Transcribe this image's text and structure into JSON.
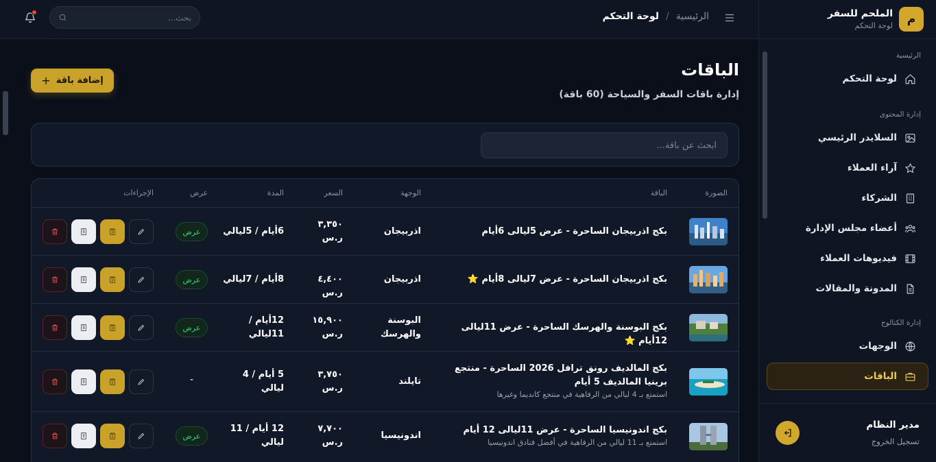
{
  "sidebar": {
    "brand_initial": "م",
    "brand_name": "الملحم للسفر",
    "brand_sub": "لوحة التحكم",
    "sections": [
      {
        "title": "الرئيسية"
      },
      {
        "title": "إدارة المحتوى"
      },
      {
        "title": "إدارة الكتالوج"
      }
    ],
    "items": [
      {
        "label": "لوحة التحكم",
        "icon": "home-icon"
      },
      {
        "label": "السلايدر الرئيسي",
        "icon": "image-icon"
      },
      {
        "label": "آراء العملاء",
        "icon": "star-icon"
      },
      {
        "label": "الشركاء",
        "icon": "building-icon"
      },
      {
        "label": "أعضاء مجلس الإدارة",
        "icon": "users-icon"
      },
      {
        "label": "فيديوهات العملاء",
        "icon": "film-icon"
      },
      {
        "label": "المدونة والمقالات",
        "icon": "document-icon"
      },
      {
        "label": "الوجهات",
        "icon": "globe-icon"
      },
      {
        "label": "الباقات",
        "icon": "briefcase-icon",
        "active": true
      }
    ],
    "user_name": "مدير النظام",
    "logout_label": "تسجيل الخروج"
  },
  "topbar": {
    "breadcrumb_home": "الرئيسية",
    "breadcrumb_sep": "/",
    "breadcrumb_current": "لوحة التحكم",
    "search_placeholder": "بحث..."
  },
  "page": {
    "title": "الباقات",
    "subtitle": "إدارة باقات السفر والسياحة (60 باقة)",
    "add_button": "إضافة باقة",
    "filter_placeholder": "ابحث عن باقة..."
  },
  "table": {
    "headers": {
      "image": "الصورة",
      "package": "الباقة",
      "destination": "الوجهة",
      "price": "السعر",
      "duration": "المدة",
      "display": "عرض",
      "actions": "الإجراءات"
    },
    "rows": [
      {
        "title": "بكج اذربيجان الساحرة - عرض 5ليالى 6أيام",
        "desc": "",
        "destination": "اذربيجان",
        "price": "٣,٣٥٠ ر.س",
        "duration": "6أيام / 5ليالي",
        "status": "عرض",
        "thumb": "city"
      },
      {
        "title": "بكج اذربيجان الساحرة - عرض 7ليالى 8أيام ⭐",
        "desc": "",
        "destination": "اذربيجان",
        "price": "٤,٤٠٠ ر.س",
        "duration": "8أيام / 7ليالي",
        "status": "عرض",
        "thumb": "city"
      },
      {
        "title": "بكج البوسنة والهرسك الساحرة - عرض 11ليالى 12أيام ⭐",
        "desc": "",
        "destination": "البوسنة والهرسك",
        "price": "١٥,٩٠٠ ر.س",
        "duration": "12أيام / 11ليالي",
        "status": "عرض",
        "thumb": "river"
      },
      {
        "title": "بكج المالديف رونق ترافل 2026 الساحرة - منتجع برينيا المالديف 5 أيام",
        "desc": "استمتع بـ 4 ليالي من الرفاهية في منتجع كانديما وغيرها",
        "destination": "تايلند",
        "price": "٣,٧٥٠ ر.س",
        "duration": "5 أيام / 4 ليالي",
        "status": "-",
        "thumb": "beach"
      },
      {
        "title": "بكج اندونيسيا الساحرة - عرض 11ليالى 12 أيام",
        "desc": "استمتع بـ 11 ليالي من الرفاهية في أفضل فنادق اندونيسيا",
        "destination": "اندونيسيا",
        "price": "٧,٧٠٠ ر.س",
        "duration": "12 أيام / 11 ليالي",
        "status": "عرض",
        "thumb": "towers"
      }
    ]
  },
  "colors": {
    "accent": "#c9a22a",
    "bg": "#0b0f1a",
    "card": "#111827",
    "success": "#3ccf7a",
    "danger": "#e84c4c"
  }
}
